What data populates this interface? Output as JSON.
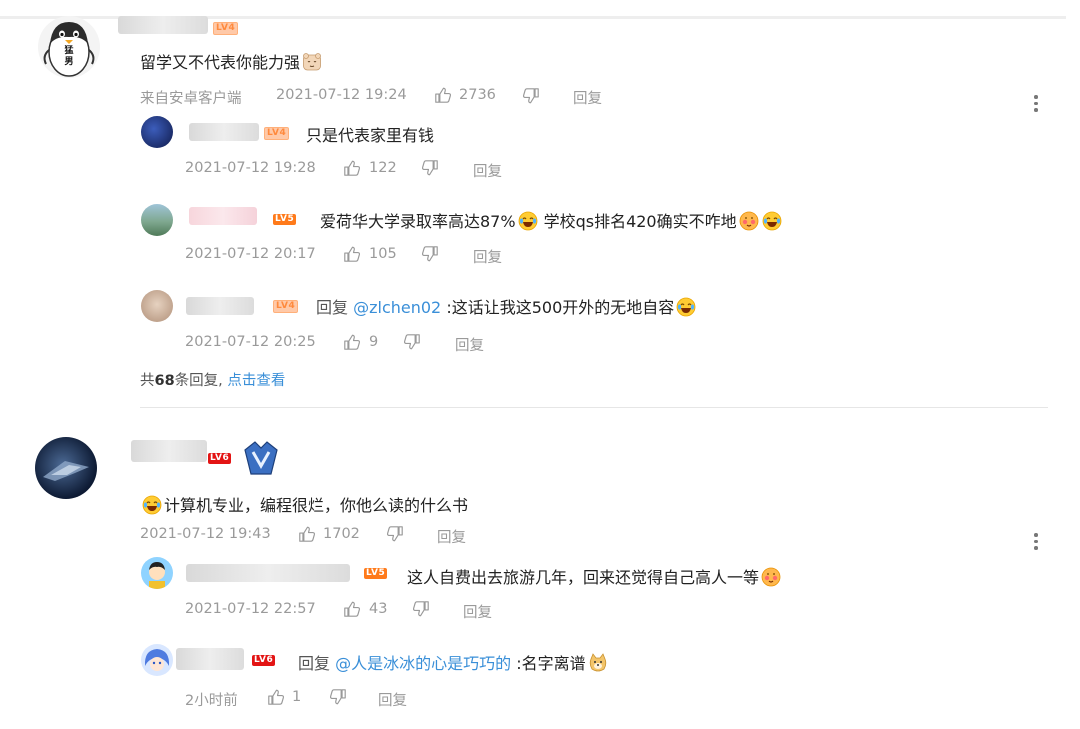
{
  "c1": {
    "level": "LV4",
    "text": "留学又不代表你能力强",
    "source": "来自安卓客户端",
    "time": "2021-07-12 19:24",
    "likes": "2736",
    "reply": "回复",
    "avatar_text": "猛男",
    "replies": [
      {
        "level": "LV4",
        "text": "只是代表家里有钱",
        "time": "2021-07-12 19:28",
        "likes": "122",
        "reply": "回复"
      },
      {
        "level": "LV5",
        "text_a": "爱荷华大学录取率高达87%",
        "text_b": "学校qs排名420确实不咋地",
        "time": "2021-07-12 20:17",
        "likes": "105",
        "reply": "回复"
      },
      {
        "level": "LV4",
        "prefix": "回复",
        "mention": "@zlchen02",
        "text": ":这话让我这500开外的无地自容",
        "time": "2021-07-12 20:25",
        "likes": "9",
        "reply": "回复"
      }
    ],
    "more_prefix": "共",
    "more_count": "68",
    "more_suffix": "条回复,",
    "more_link": "点击查看"
  },
  "c2": {
    "level": "LV6",
    "text": "计算机专业，编程很烂，你他么读的什么书",
    "time": "2021-07-12 19:43",
    "likes": "1702",
    "reply": "回复",
    "replies": [
      {
        "level": "LV5",
        "text": "这人自费出去旅游几年，回来还觉得自己高人一等",
        "time": "2021-07-12 22:57",
        "likes": "43",
        "reply": "回复"
      },
      {
        "level": "LV6",
        "prefix": "回复",
        "mention": "@人是冰冰的心是巧巧的",
        "text": ":名字离谱",
        "time": "2小时前",
        "likes": "1",
        "reply": "回复"
      }
    ]
  },
  "colors": {
    "link": "#3a8fd8",
    "meta": "#9a9a9a",
    "lv4": "#ffb07a",
    "lv5": "#ff7a1a",
    "lv6": "#e31414"
  },
  "icons": [
    "thumb-up-icon",
    "thumb-down-icon",
    "more-dots-icon",
    "laugh-cry-emoji",
    "smile-emoji",
    "doge-emoji",
    "crown-badge-icon"
  ]
}
